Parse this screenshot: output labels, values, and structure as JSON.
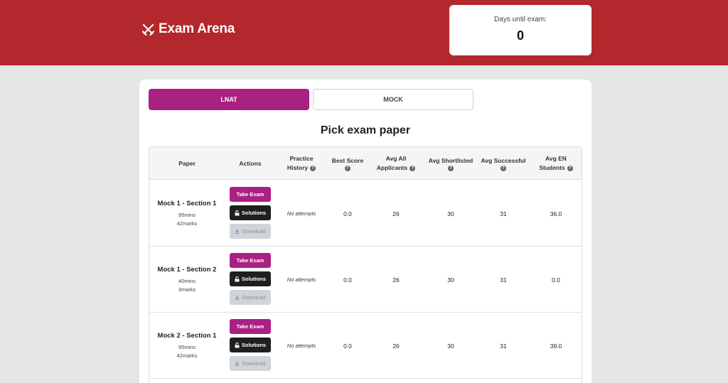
{
  "brand": {
    "name": "Exam Arena",
    "icon": "crossed-swords-icon"
  },
  "countdown": {
    "label": "Days until exam:",
    "value": "0"
  },
  "tabs": [
    {
      "label": "LNAT",
      "active": true
    },
    {
      "label": "MOCK",
      "active": false
    }
  ],
  "page_title": "Pick exam paper",
  "table": {
    "headers": {
      "paper": "Paper",
      "actions": "Actions",
      "practice_1": "Practice",
      "practice_2": "History",
      "best_score": "Best Score",
      "avg_all_1": "Avg All",
      "avg_all_2": "Applicants",
      "avg_short": "Avg Shortlisted",
      "avg_succ": "Avg Successful",
      "avg_en_1": "Avg EN",
      "avg_en_2": "Students"
    },
    "buttons": {
      "take": "Take Exam",
      "solutions": "Solutions",
      "download": "Download"
    },
    "rows": [
      {
        "paper": "Mock 1 - Section 1",
        "mins": "95mins",
        "marks": "42marks",
        "history": "No attempts",
        "best": "0.0",
        "avg_all": "26",
        "avg_short": "30",
        "avg_succ": "31",
        "avg_en": "36.0"
      },
      {
        "paper": "Mock 1 - Section 2",
        "mins": "40mins",
        "marks": "3marks",
        "history": "No attempts",
        "best": "0.0",
        "avg_all": "26",
        "avg_short": "30",
        "avg_succ": "31",
        "avg_en": "0.0"
      },
      {
        "paper": "Mock 2 - Section 1",
        "mins": "95mins",
        "marks": "42marks",
        "history": "No attempts",
        "best": "0.0",
        "avg_all": "26",
        "avg_short": "30",
        "avg_succ": "31",
        "avg_en": "39.0"
      }
    ]
  },
  "colors": {
    "header": "#b3282c",
    "accent": "#a82183",
    "dark": "#1f1f1f"
  }
}
